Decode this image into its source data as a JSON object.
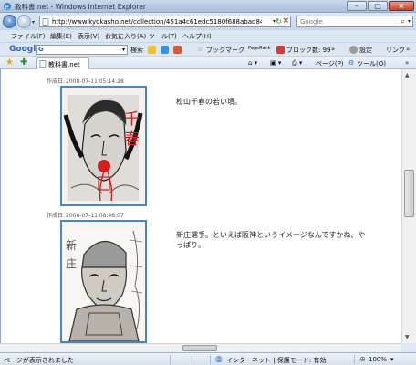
{
  "window": {
    "title": "教科書.net - Windows Internet Explorer"
  },
  "address": {
    "url": "http://www.kyokasho.net/collection/451a4c61edc5180f688abad8464f2fec/",
    "search_placeholder": "Google"
  },
  "menu": {
    "items": [
      "ファイル(F)",
      "編集(E)",
      "表示(V)",
      "お気に入り(A)",
      "ツール(T)",
      "ヘルプ(H)"
    ]
  },
  "google_toolbar": {
    "logo": "Google",
    "search_label": "検索",
    "bookmarks_label": "ブックマーク",
    "pagerank_label": "PageRank",
    "blocked_label": "ブロック数: 99",
    "more": "»",
    "settings_label": "設定",
    "links_label": "リンク",
    "more2": "»"
  },
  "tab": {
    "label": "教科書.net"
  },
  "commands": {
    "page_label": "ページ(P)",
    "tools_label": "ツール(O)",
    "more": "»"
  },
  "entries": [
    {
      "date_label": "作成日:",
      "date": "2008-07-11 05:14:28",
      "caption": "松山千春の若い頃。",
      "image_icon": "sketch-portrait-matsuyama"
    },
    {
      "date_label": "作成日:",
      "date": "2008-07-11 08:46:07",
      "caption": "新庄選手。といえば阪神というイメージなんですかね、やっぱり。",
      "image_icon": "sketch-portrait-shinjo"
    }
  ],
  "statusbar": {
    "status": "ページが表示されました",
    "zone": "インターネット | 保護モード: 有効",
    "zoom": "100%"
  },
  "colors": {
    "image_border": "#4a87b8",
    "window_chrome": "#dfe8f2"
  }
}
